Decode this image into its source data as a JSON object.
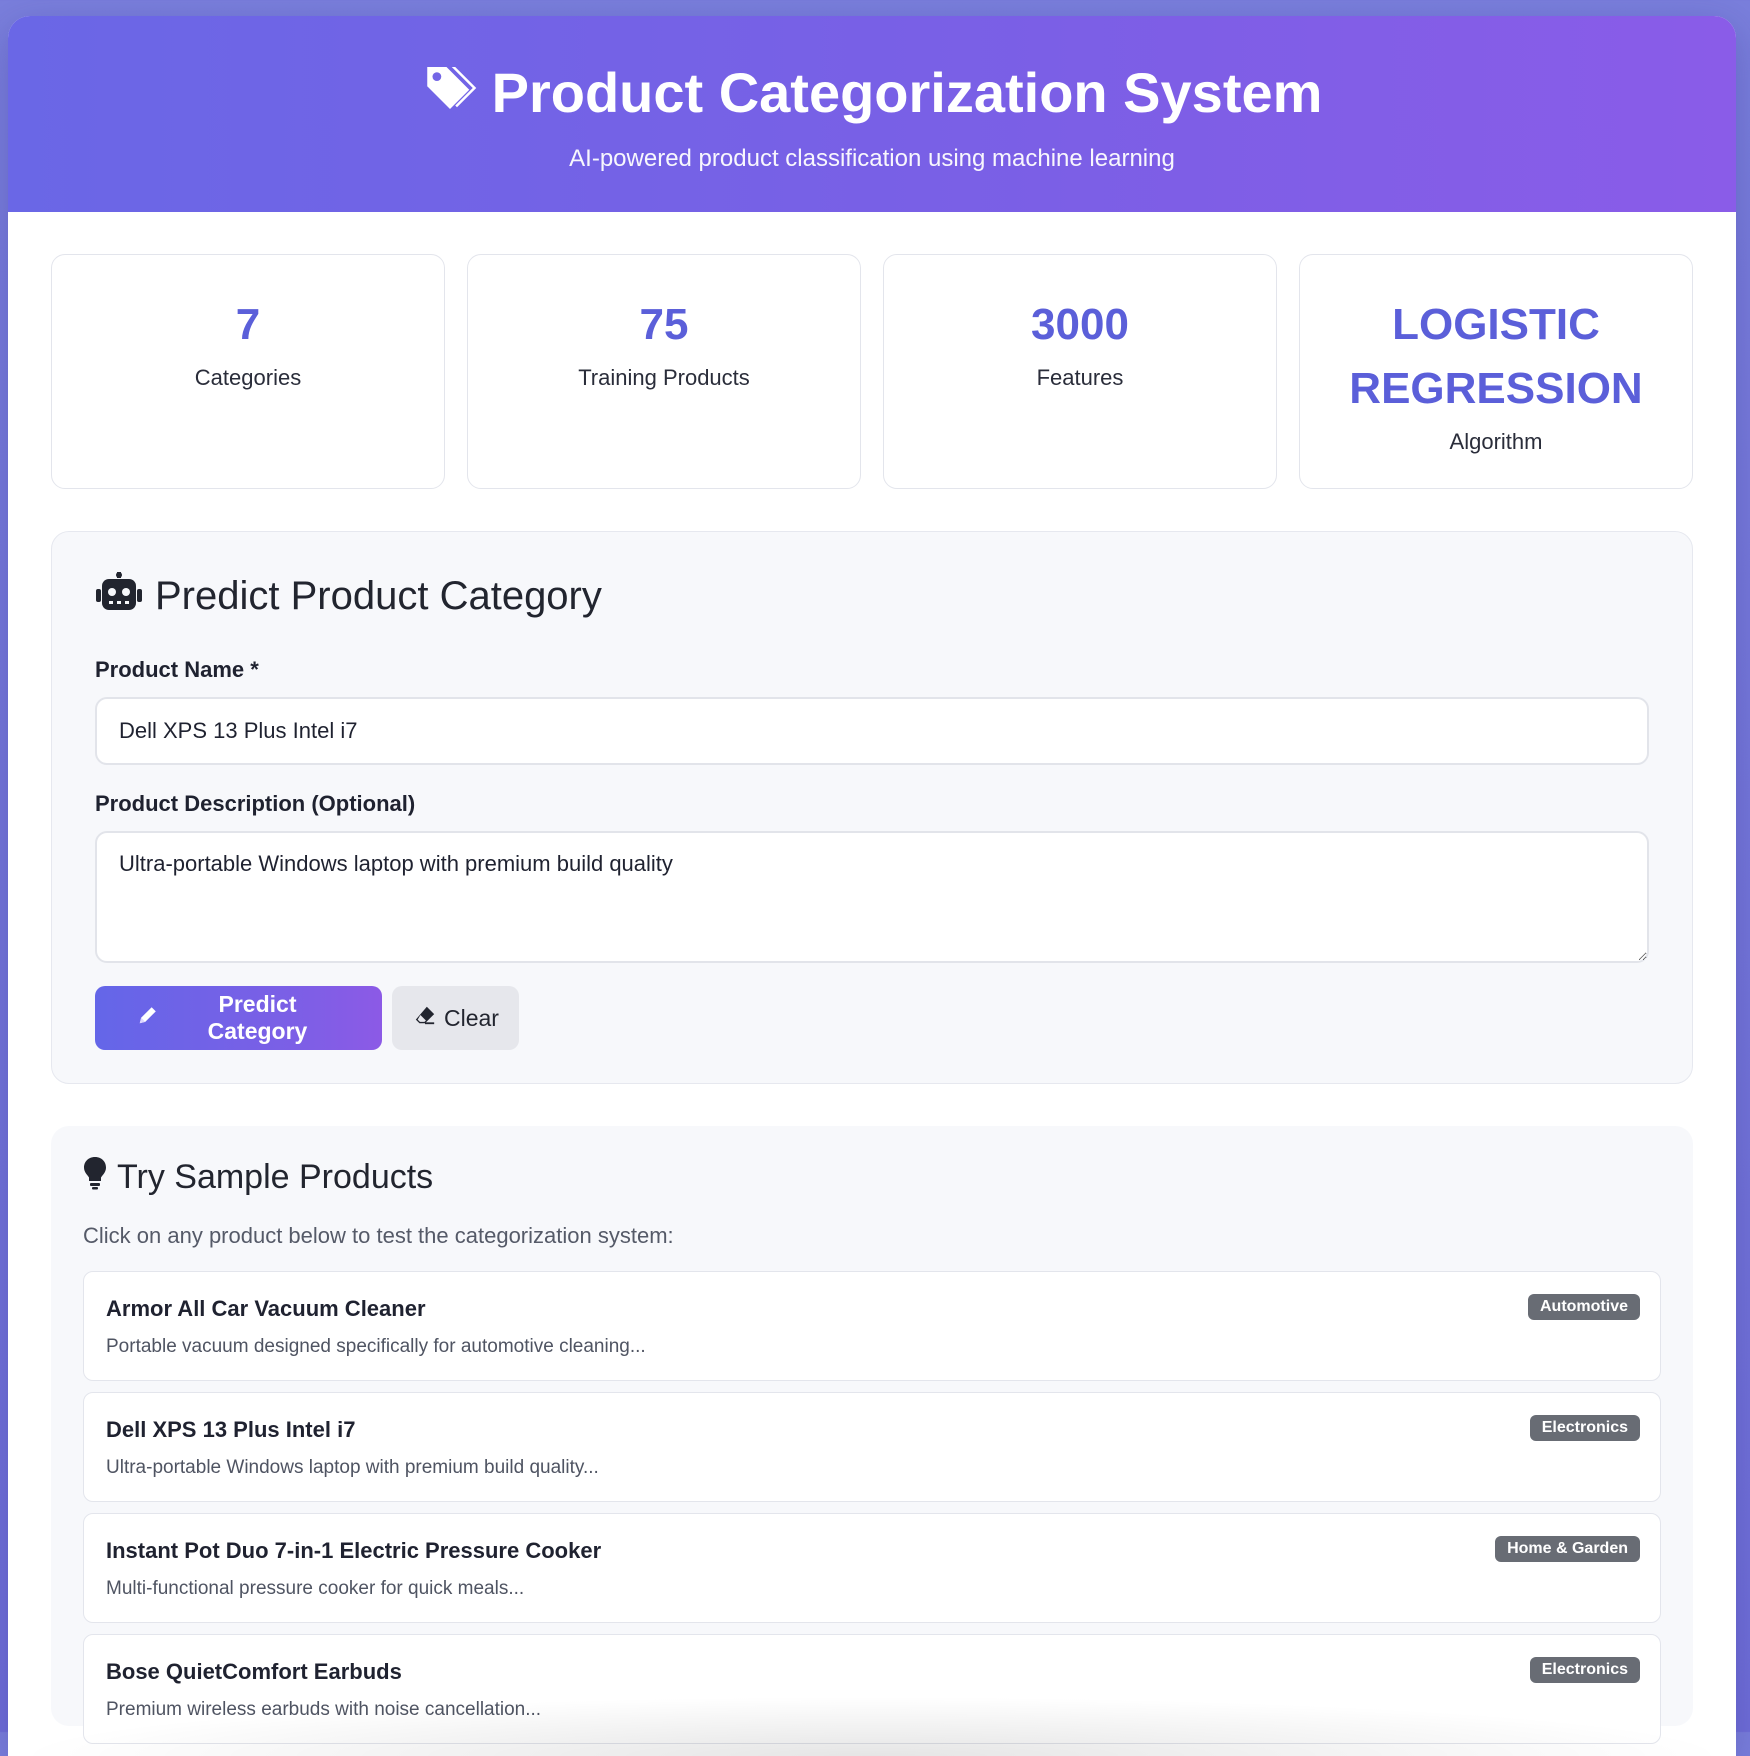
{
  "header": {
    "title": "Product Categorization System",
    "subtitle": "AI-powered product classification using machine learning",
    "icon": "tags-icon"
  },
  "stats": [
    {
      "value": "7",
      "label": "Categories"
    },
    {
      "value": "75",
      "label": "Training Products"
    },
    {
      "value": "3000",
      "label": "Features"
    },
    {
      "value": "LOGISTIC REGRESSION",
      "label": "Algorithm"
    }
  ],
  "predict": {
    "title": "Predict Product Category",
    "icon": "robot-icon",
    "name_label": "Product Name *",
    "name_value": "Dell XPS 13 Plus Intel i7",
    "desc_label": "Product Description (Optional)",
    "desc_value": "Ultra-portable Windows laptop with premium build quality",
    "predict_button": "Predict Category",
    "clear_button": "Clear"
  },
  "samples": {
    "title": "Try Sample Products",
    "icon": "lightbulb-icon",
    "hint": "Click on any product below to test the categorization system:",
    "items": [
      {
        "name": "Armor All Car Vacuum Cleaner",
        "desc": "Portable vacuum designed specifically for automotive cleaning...",
        "category": "Automotive"
      },
      {
        "name": "Dell XPS 13 Plus Intel i7",
        "desc": "Ultra-portable Windows laptop with premium build quality...",
        "category": "Electronics"
      },
      {
        "name": "Instant Pot Duo 7-in-1 Electric Pressure Cooker",
        "desc": "Multi-functional pressure cooker for quick meals...",
        "category": "Home & Garden"
      },
      {
        "name": "Bose QuietComfort Earbuds",
        "desc": "Premium wireless earbuds with noise cancellation...",
        "category": "Electronics"
      }
    ]
  },
  "colors": {
    "accent": "#5b5fd9",
    "header_gradient_start": "#6a67e6",
    "header_gradient_end": "#8a5ce8",
    "badge": "#686c74"
  }
}
